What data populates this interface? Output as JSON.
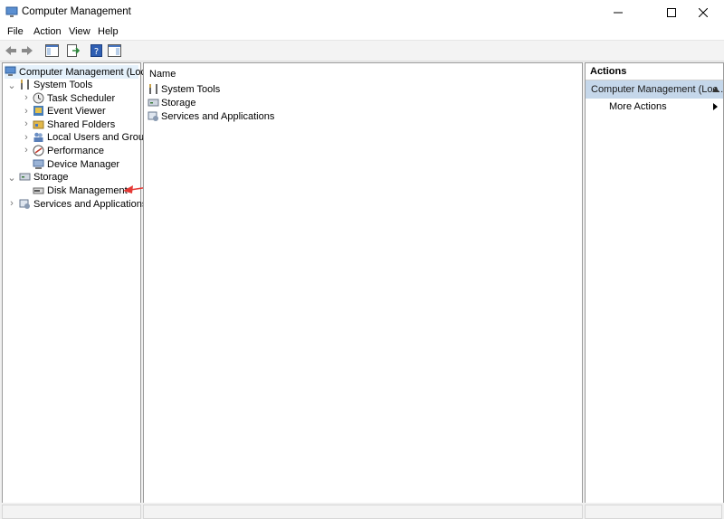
{
  "window": {
    "title": "Computer Management"
  },
  "menu": [
    "File",
    "Action",
    "View",
    "Help"
  ],
  "tree": {
    "root": "Computer Management (Local)",
    "system_tools": "System Tools",
    "task_scheduler": "Task Scheduler",
    "event_viewer": "Event Viewer",
    "shared_folders": "Shared Folders",
    "local_users": "Local Users and Groups",
    "performance": "Performance",
    "device_manager": "Device Manager",
    "storage": "Storage",
    "disk_management": "Disk Management",
    "services": "Services and Applications"
  },
  "list": {
    "header": "Name",
    "items": [
      "System Tools",
      "Storage",
      "Services and Applications"
    ]
  },
  "actions": {
    "header": "Actions",
    "section": "Computer Management (Loc...",
    "more": "More Actions"
  },
  "colors": {
    "arrow": "#e53935",
    "selection": "#c5d7ea"
  }
}
